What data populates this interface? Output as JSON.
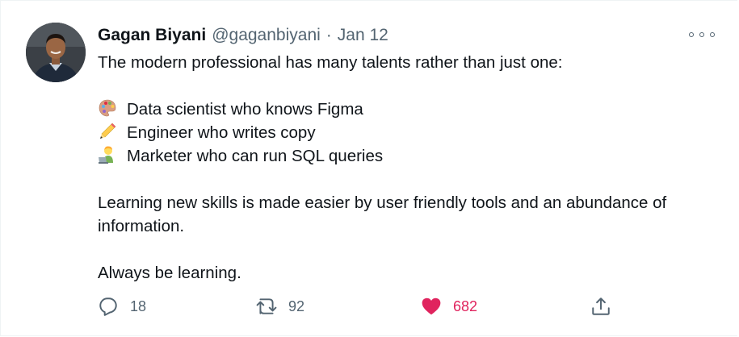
{
  "author": {
    "name": "Gagan Biyani",
    "handle": "@gaganbiyani",
    "separator": "·",
    "date": "Jan 12"
  },
  "tweet": {
    "lines": [
      "The modern professional has many talents rather than just one:",
      "",
      "Data scientist who knows Figma",
      "Engineer who writes copy",
      "Marketer who can run SQL queries",
      "",
      "Learning new skills is made easier by user friendly tools and an abundance of",
      "information.",
      "",
      "Always be learning."
    ],
    "emojis": [
      "artist-palette-icon",
      "pencil-icon",
      "technologist-icon"
    ]
  },
  "actions": {
    "replies": "18",
    "retweets": "92",
    "likes": "682",
    "share": ""
  },
  "colors": {
    "secondary_text": "#536471",
    "like": "#e0245e",
    "border": "#eff3f4"
  }
}
